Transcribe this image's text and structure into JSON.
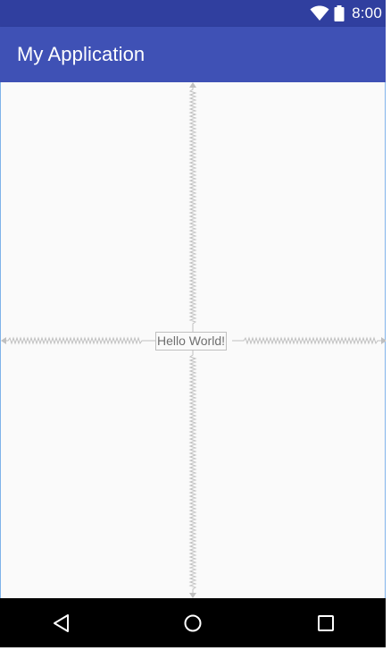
{
  "status_bar": {
    "time": "8:00",
    "icons": [
      "wifi-icon",
      "battery-icon"
    ]
  },
  "app_bar": {
    "title": "My Application"
  },
  "content": {
    "text_view": "Hello World!"
  },
  "nav_bar": {
    "buttons": [
      "back-icon",
      "home-icon",
      "recents-icon"
    ]
  },
  "colors": {
    "status_bar": "#303f9f",
    "app_bar": "#3f51b5",
    "background": "#fafafa",
    "constraint": "#c0c0c0",
    "nav_bar": "#000000"
  }
}
